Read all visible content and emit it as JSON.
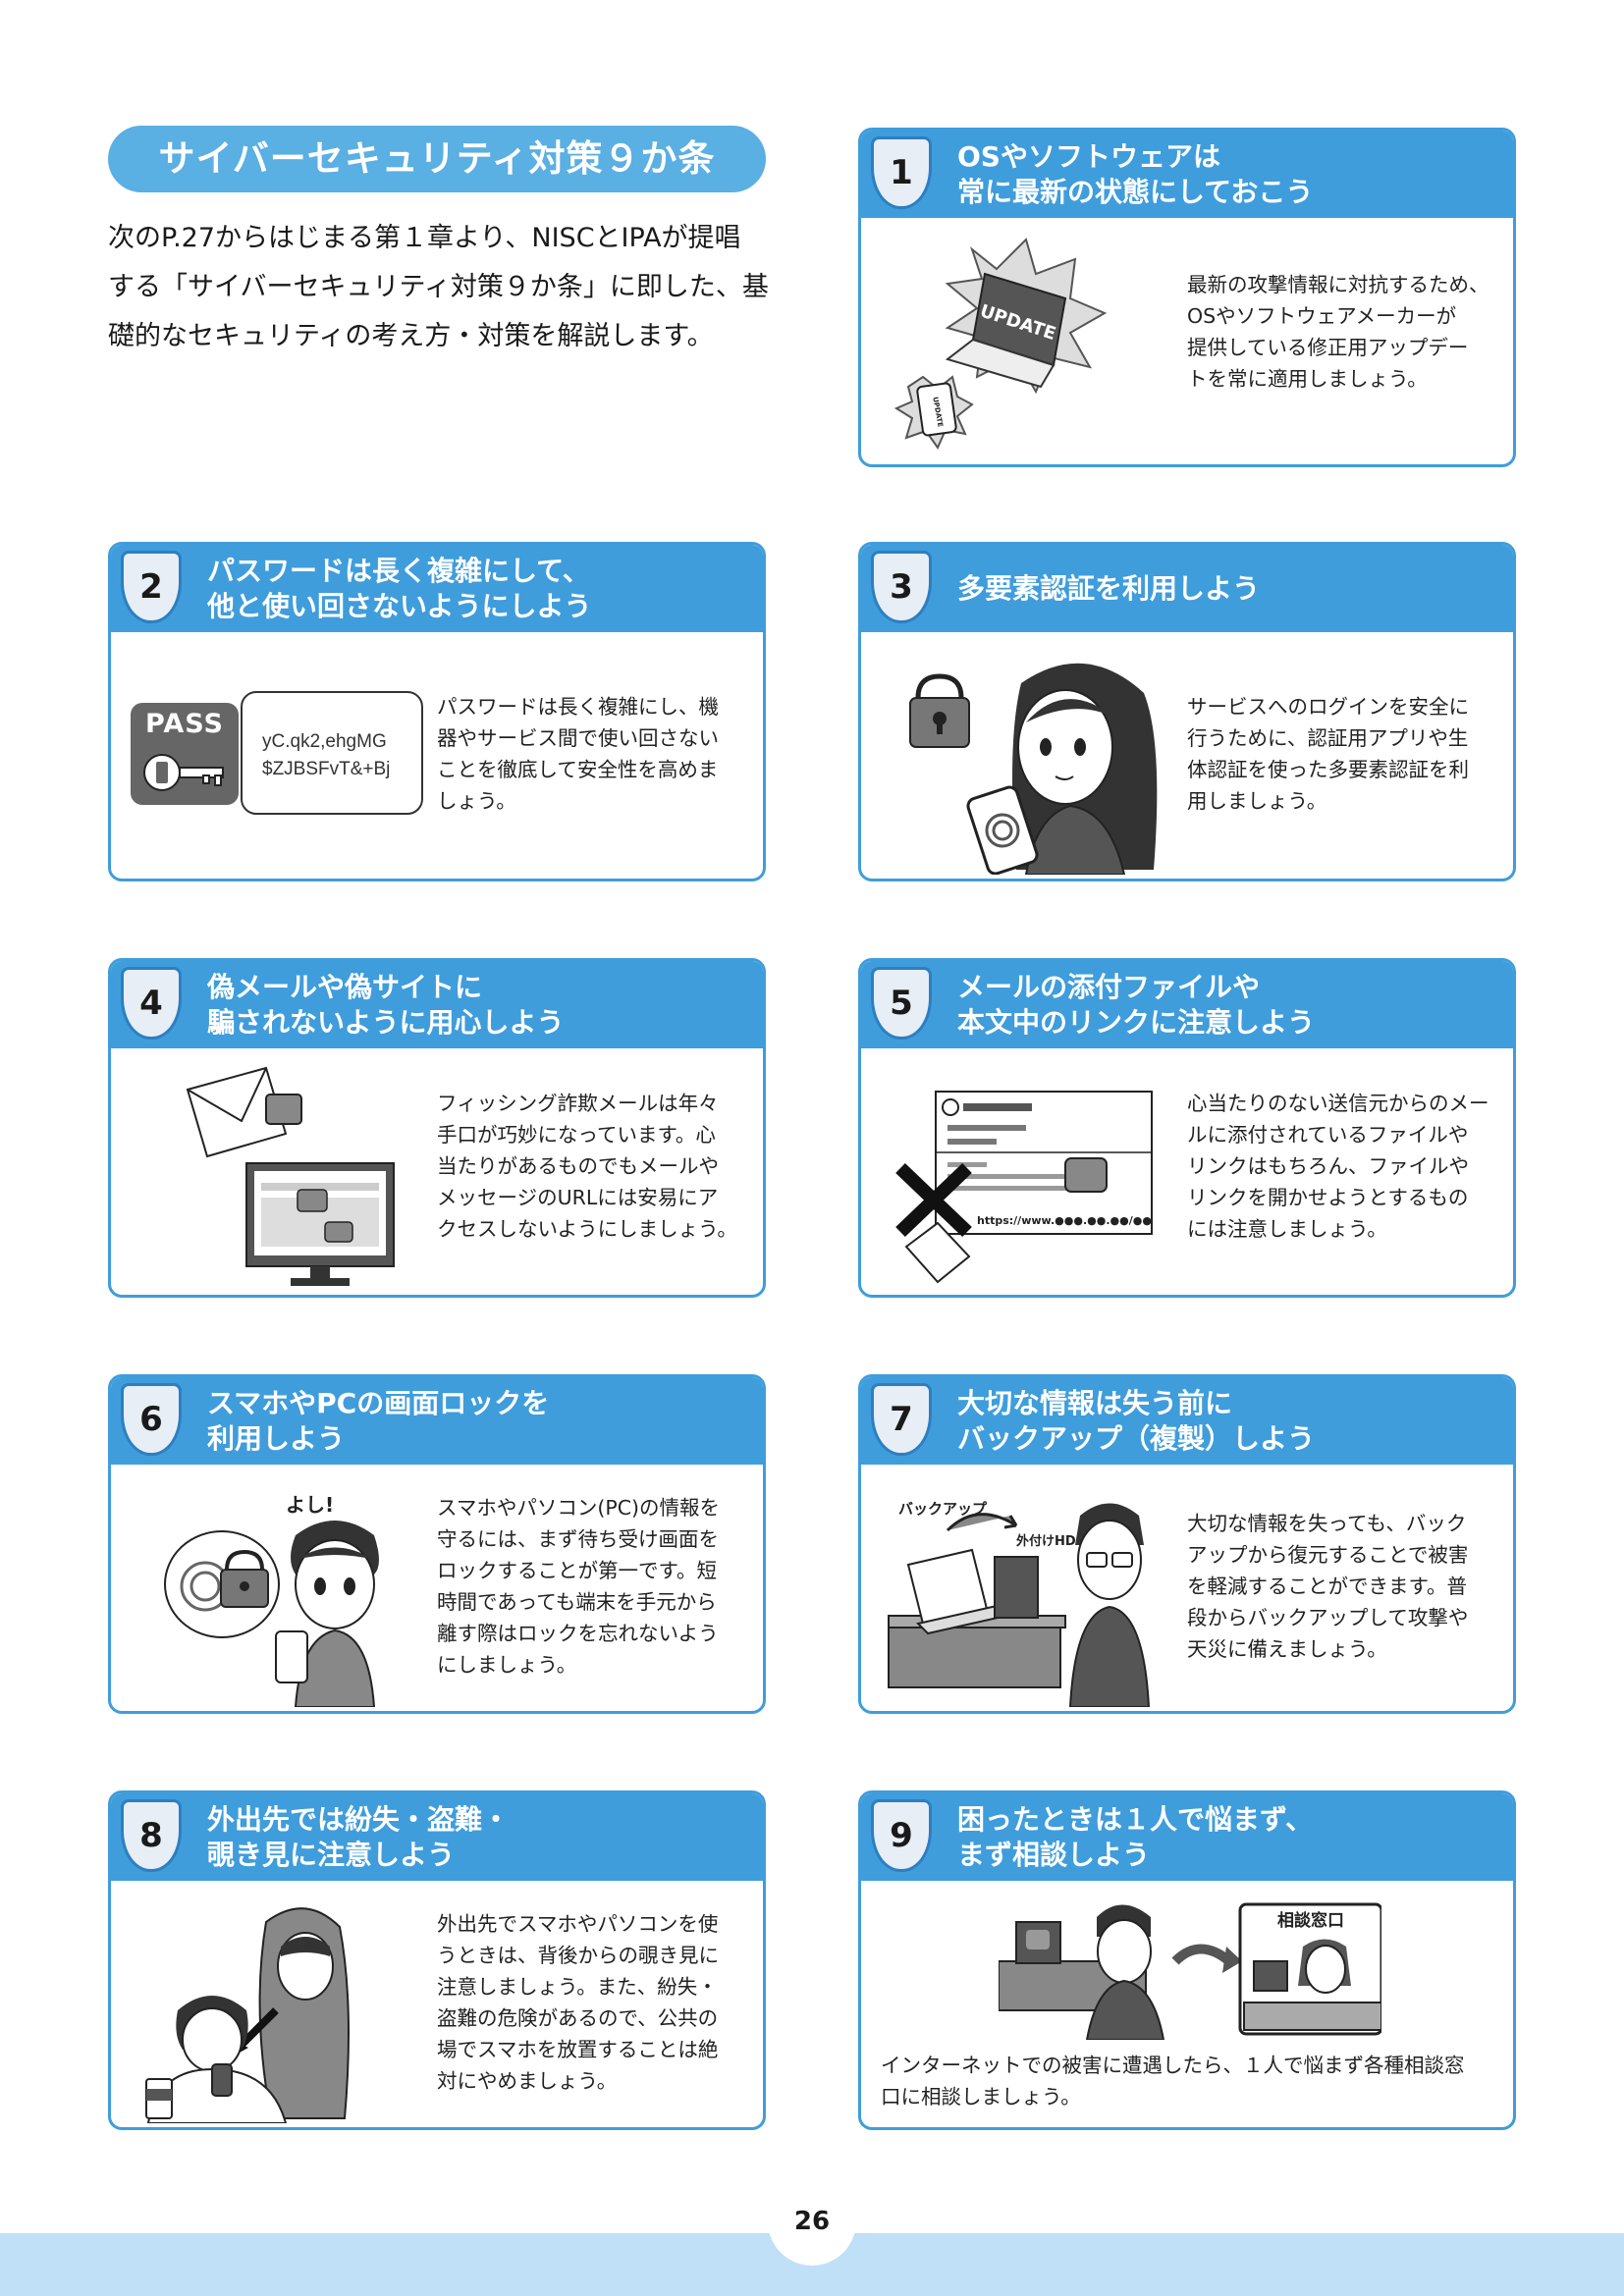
{
  "intro": {
    "title": "サイバーセキュリティ対策９か条",
    "lines": [
      "次のP.27からはじまる第１章より、NISCとIPAが提唱",
      "する「サイバーセキュリティ対策９か条」に即した、基",
      "礎的なセキュリティの考え方・対策を解説します。"
    ]
  },
  "cards": [
    {
      "number": "1",
      "title_lines": [
        "OSやソフトウェアは",
        "常に最新の状態にしておこう"
      ],
      "text_lines": [
        "最新の攻撃情報に対抗するため、",
        "OSやソフトウェアメーカーが",
        "提供している修正用アップデー",
        "トを常に適用しましょう。"
      ],
      "illus_labels": [
        "UPDATE",
        "UPDATE"
      ]
    },
    {
      "number": "2",
      "title_lines": [
        "パスワードは長く複雑にして、",
        "他と使い回さないようにしよう"
      ],
      "text_lines": [
        "パスワードは長く複雑にし、機",
        "器やサービス間で使い回さない",
        "ことを徹底して安全性を高めま",
        "しょう。"
      ],
      "illus_labels": [
        "PASS",
        "yC.qk2,ehgMG",
        "$ZJBSFvT&+Bj"
      ]
    },
    {
      "number": "3",
      "title_lines": [
        "多要素認証を利用しよう"
      ],
      "text_lines": [
        "サービスへのログインを安全に",
        "行うために、認証用アプリや生",
        "体認証を使った多要素認証を利",
        "用しましょう。"
      ],
      "illus_labels": []
    },
    {
      "number": "4",
      "title_lines": [
        "偽メールや偽サイトに",
        "騙されないように用心しよう"
      ],
      "text_lines": [
        "フィッシング詐欺メールは年々",
        "手口が巧妙になっています。心",
        "当たりがあるものでもメールや",
        "メッセージのURLには安易にア",
        "クセスしないようにしましょう。"
      ],
      "illus_labels": []
    },
    {
      "number": "5",
      "title_lines": [
        "メールの添付ファイルや",
        "本文中のリンクに注意しよう"
      ],
      "text_lines": [
        "心当たりのない送信元からのメー",
        "ルに添付されているファイルや",
        "リンクはもちろん、ファイルや",
        "リンクを開かせようとするもの",
        "には注意しましょう。"
      ],
      "illus_labels": [
        "https://www.●●●.●●.●●/●●"
      ]
    },
    {
      "number": "6",
      "title_lines": [
        "スマホやPCの画面ロックを",
        "利用しよう"
      ],
      "text_lines": [
        "スマホやパソコン(PC)の情報を",
        "守るには、まず待ち受け画面を",
        "ロックすることが第一です。短",
        "時間であっても端末を手元から",
        "離す際はロックを忘れないよう",
        "にしましょう。"
      ],
      "illus_labels": [
        "よし!"
      ]
    },
    {
      "number": "7",
      "title_lines": [
        "大切な情報は失う前に",
        "バックアップ（複製）しよう"
      ],
      "text_lines": [
        "大切な情報を失っても、バック",
        "アップから復元することで被害",
        "を軽減することができます。普",
        "段からバックアップして攻撃や",
        "天災に備えましょう。"
      ],
      "illus_labels": [
        "バックアップ",
        "外付けHDD"
      ]
    },
    {
      "number": "8",
      "title_lines": [
        "外出先では紛失・盗難・",
        "覗き見に注意しよう"
      ],
      "text_lines": [
        "外出先でスマホやパソコンを使",
        "うときは、背後からの覗き見に",
        "注意しましょう。また、紛失・",
        "盗難の危険があるので、公共の",
        "場でスマホを放置することは絶",
        "対にやめましょう。"
      ],
      "illus_labels": []
    },
    {
      "number": "9",
      "title_lines": [
        "困ったときは１人で悩まず、",
        "まず相談しよう"
      ],
      "text_lines": [
        "インターネットでの被害に遭遇したら、１人で悩まず各種相談窓",
        "口に相談しましょう。"
      ],
      "illus_labels": [
        "相談窓口"
      ]
    }
  ],
  "page_number": "26",
  "colors": {
    "accent": "#3f9ddc",
    "intro_title_bg": "#5aafe3",
    "footer_band": "#bfe0f6"
  }
}
